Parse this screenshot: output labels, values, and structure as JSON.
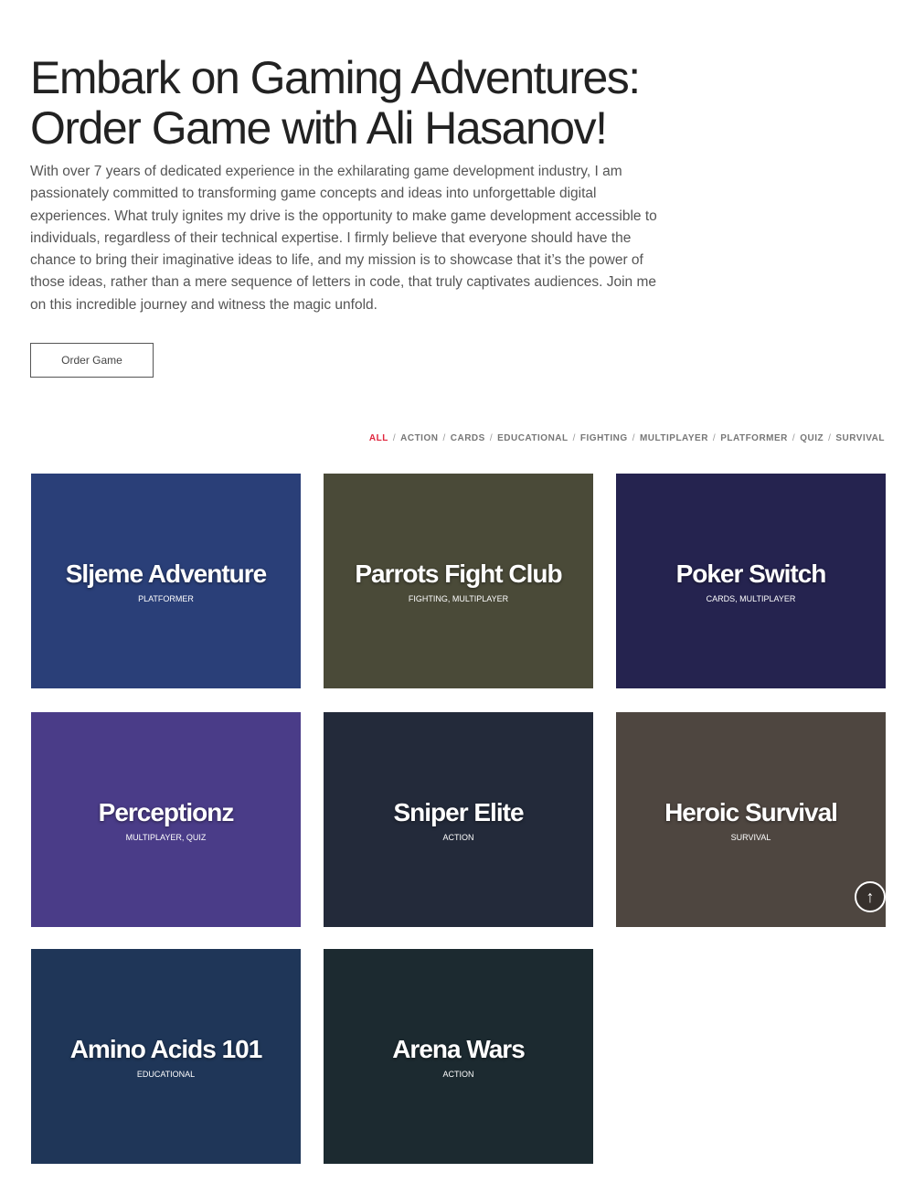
{
  "hero": {
    "title": "Embark on Gaming Adventures: Order Game with Ali Hasanov!",
    "description": "With over 7 years of dedicated experience in the exhilarating game development industry, I am passionately committed to transforming game concepts and ideas into unforgettable digital experiences. What truly ignites my drive is the opportunity to make game development accessible to individuals, regardless of their technical expertise. I firmly believe that everyone should have the chance to bring their imaginative ideas to life, and my mission is to showcase that it’s the power of those ideas, rather than a mere sequence of letters in code, that truly captivates audiences. Join me on this incredible journey and witness the magic unfold.",
    "button": "Order Game"
  },
  "filters": [
    "ALL",
    "ACTION",
    "CARDS",
    "EDUCATIONAL",
    "FIGHTING",
    "MULTIPLAYER",
    "PLATFORMER",
    "QUIZ",
    "SURVIVAL"
  ],
  "active_filter": "ALL",
  "accent": "#e0263e",
  "games": [
    {
      "title": "Sljeme Adventure",
      "category": "PLATFORMER",
      "bg": "#2a3f78"
    },
    {
      "title": "Parrots Fight Club",
      "category": "FIGHTING, MULTIPLAYER",
      "bg": "#4a4a38"
    },
    {
      "title": "Poker Switch",
      "category": "CARDS, MULTIPLAYER",
      "bg": "#25234f"
    },
    {
      "title": "Perceptionz",
      "category": "MULTIPLAYER, QUIZ",
      "bg": "#4a3c88"
    },
    {
      "title": "Sniper Elite",
      "category": "ACTION",
      "bg": "#232a3a"
    },
    {
      "title": "Heroic Survival",
      "category": "SURVIVAL",
      "bg": "#4e4640"
    },
    {
      "title": "Amino Acids 101",
      "category": "EDUCATIONAL",
      "bg": "#1f3658"
    },
    {
      "title": "Arena Wars",
      "category": "ACTION",
      "bg": "#1c2a30"
    }
  ],
  "scroll_top_icon": "arrow-up-icon"
}
